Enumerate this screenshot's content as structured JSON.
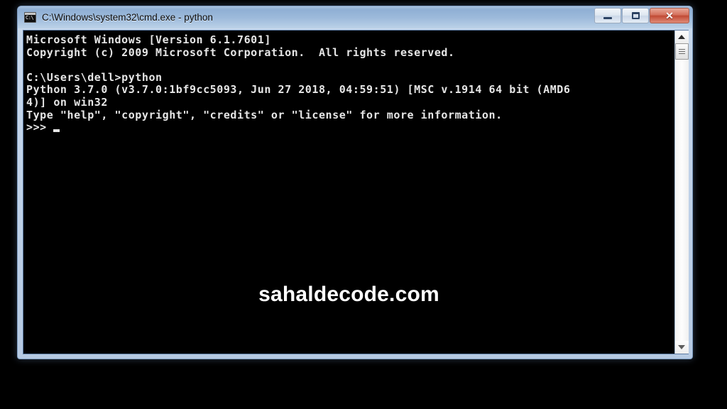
{
  "window": {
    "title": "C:\\Windows\\system32\\cmd.exe - python",
    "icon_name": "cmd-console-icon",
    "icon_glyph": "C:\\",
    "frame_color": "#b6cae3",
    "titlebar_color": "#8fafd4",
    "console_bg": "#000000",
    "console_fg": "#e6e6e6"
  },
  "controls": {
    "minimize_label": "Minimize",
    "maximize_label": "Maximize",
    "close_label": "✕",
    "close_color": "#c14a34"
  },
  "console": {
    "lines": [
      "Microsoft Windows [Version 6.1.7601]",
      "Copyright (c) 2009 Microsoft Corporation.  All rights reserved.",
      "",
      "C:\\Users\\dell>python",
      "Python 3.7.0 (v3.7.0:1bf9cc5093, Jun 27 2018, 04:59:51) [MSC v.1914 64 bit (AMD6",
      "4)] on win32",
      "Type \"help\", \"copyright\", \"credits\" or \"license\" for more information."
    ],
    "prompt": ">>>",
    "cursor": "_"
  },
  "watermark": {
    "text": "sahaldecode.com"
  },
  "scrollbar": {
    "up_arrow_name": "scroll-up-arrow",
    "down_arrow_name": "scroll-down-arrow",
    "thumb_position_percent": 0
  }
}
